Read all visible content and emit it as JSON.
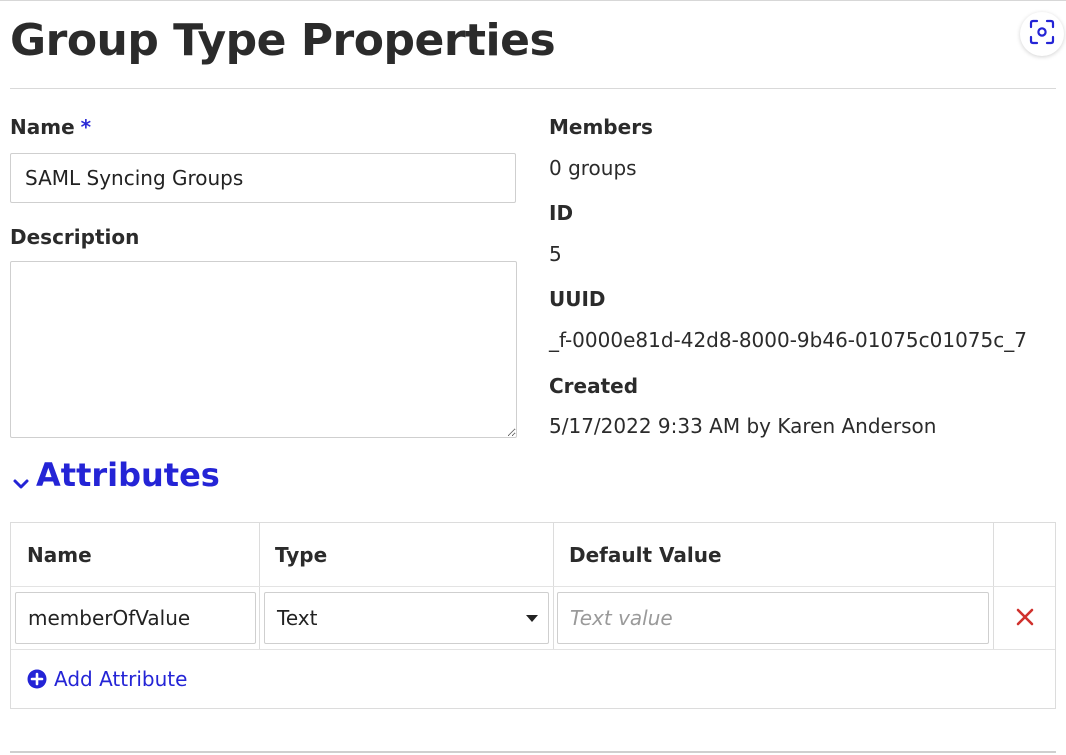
{
  "page": {
    "title": "Group Type Properties",
    "focus_icon": "focus-scan-icon"
  },
  "form": {
    "name_label": "Name",
    "required_marker": "*",
    "name_value": "SAML Syncing Groups",
    "description_label": "Description",
    "description_value": ""
  },
  "details": {
    "members_label": "Members",
    "members_value": "0 groups",
    "id_label": "ID",
    "id_value": "5",
    "uuid_label": "UUID",
    "uuid_value": "_f-0000e81d-42d8-8000-9b46-01075c01075c_7",
    "created_label": "Created",
    "created_value": "5/17/2022 9:33 AM by Karen Anderson"
  },
  "attributes": {
    "header": "Attributes",
    "expanded": true,
    "columns": [
      "Name",
      "Type",
      "Default Value"
    ],
    "rows": [
      {
        "name": "memberOfValue",
        "type": "Text",
        "default_value": "",
        "default_placeholder": "Text value"
      }
    ],
    "add_label": "Add Attribute"
  },
  "colors": {
    "accent": "#2424d6",
    "delete": "#d0312d",
    "text": "#2b2b2b",
    "border": "#cfcfcf"
  }
}
